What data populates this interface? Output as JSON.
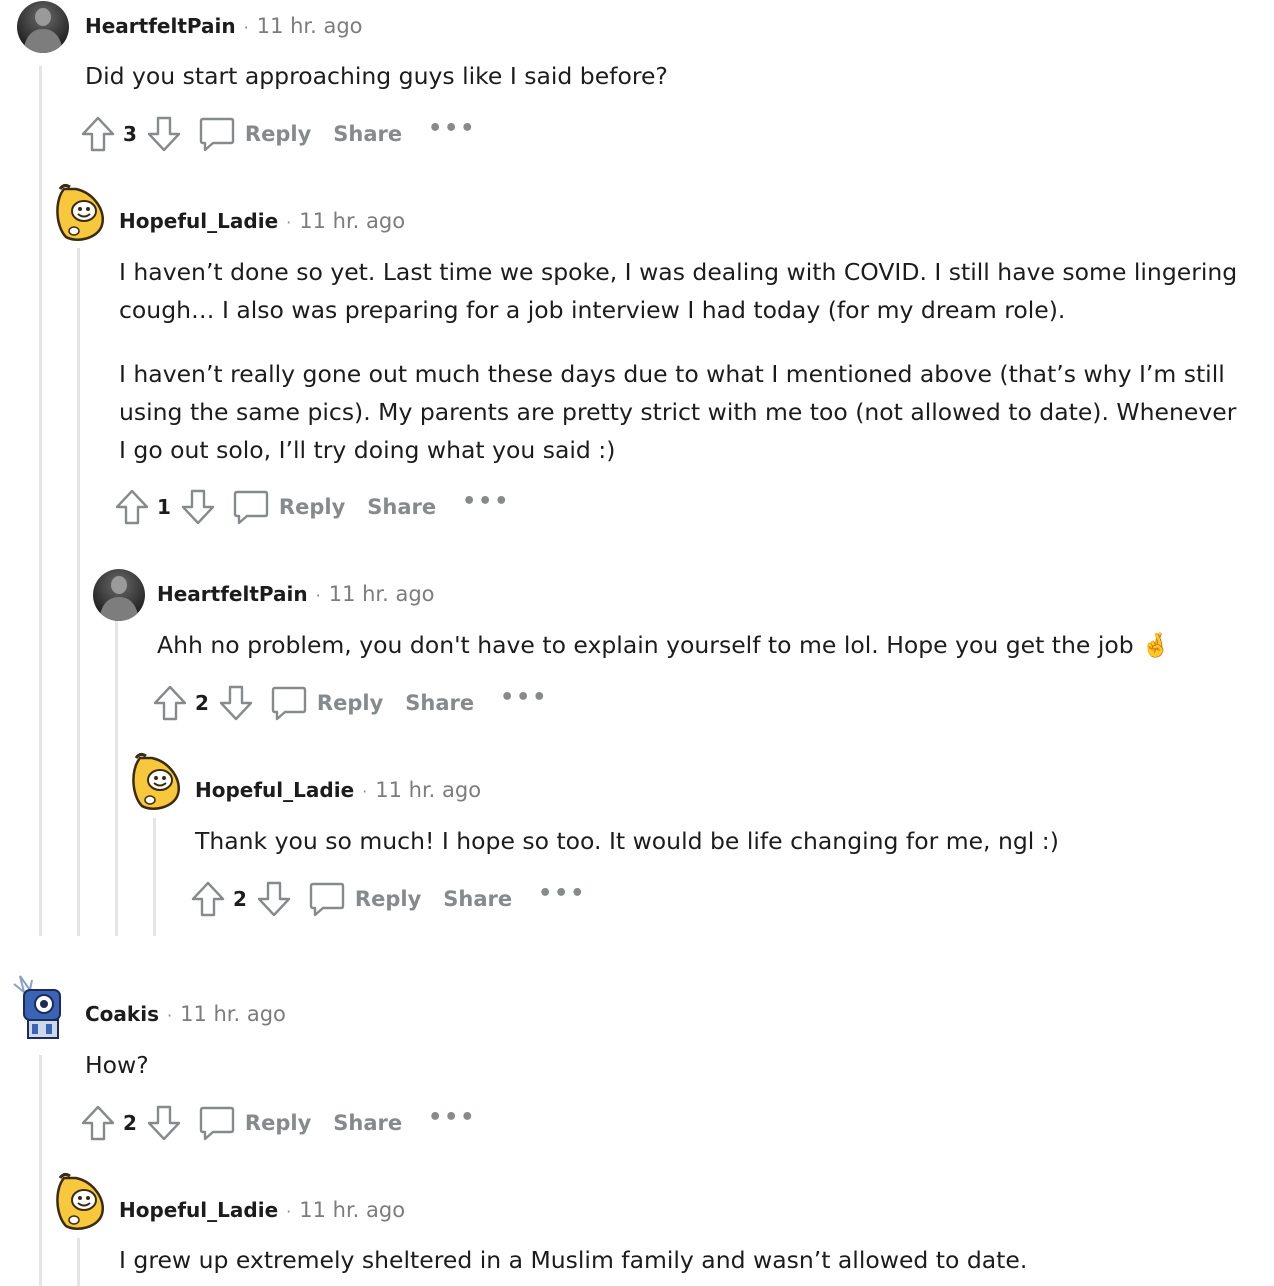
{
  "comments": [
    {
      "author": "HeartfeltPain",
      "time": "11 hr. ago",
      "paragraphs": [
        "Did you start approaching guys like I said before?"
      ],
      "votes": "3"
    },
    {
      "author": "Hopeful_Ladie",
      "time": "11 hr. ago",
      "paragraphs": [
        "I haven’t done so yet. Last time we spoke, I was dealing with COVID. I still have some lingering cough… I also was preparing for a job interview I had today (for my dream role).",
        "I haven’t really gone out much these days due to what I mentioned above (that’s why I’m still using the same pics). My parents are pretty strict with me too (not allowed to date). Whenever I go out solo, I’ll try doing what you said :)"
      ],
      "votes": "1"
    },
    {
      "author": "HeartfeltPain",
      "time": "11 hr. ago",
      "paragraphs": [
        "Ahh no problem, you don't have to explain yourself to me lol. Hope you get the job 🤞"
      ],
      "votes": "2"
    },
    {
      "author": "Hopeful_Ladie",
      "time": "11 hr. ago",
      "paragraphs": [
        "Thank you so much! I hope so too. It would be life changing for me, ngl :)"
      ],
      "votes": "2"
    },
    {
      "author": "Coakis",
      "time": "11 hr. ago",
      "paragraphs": [
        "How?"
      ],
      "votes": "2"
    },
    {
      "author": "Hopeful_Ladie",
      "time": "11 hr. ago",
      "paragraphs": [
        "I grew up extremely sheltered in a Muslim family and wasn’t allowed to date."
      ]
    }
  ],
  "actions": {
    "reply": "Reply",
    "share": "Share",
    "more": "•••",
    "separator": "·"
  },
  "icons": {
    "upvote": "upvote-arrow-icon",
    "downvote": "downvote-arrow-icon",
    "reply": "speech-bubble-icon",
    "more": "ellipsis-icon"
  },
  "colors": {
    "muted": "#878a8c",
    "thread_line": "#e5e5e5",
    "text": "#1c1c1c"
  }
}
